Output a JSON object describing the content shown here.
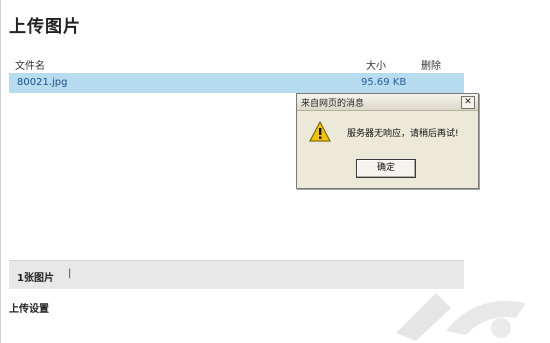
{
  "page": {
    "title": "上传图片"
  },
  "file_list": {
    "columns": {
      "name": "文件名",
      "size": "大小",
      "delete": "删除"
    },
    "rows": [
      {
        "name": "80021.jpg",
        "size": "95.69 KB"
      }
    ]
  },
  "footer": {
    "count": "1张图片",
    "separator": "|"
  },
  "upload_settings": {
    "label": "上传设置"
  },
  "dialog": {
    "title": "来自网页的消息",
    "message": "服务器无响应，请稍后再试!",
    "ok_label": "确定",
    "close_label": "✕"
  },
  "colors": {
    "selected_row": "#b7dcf0",
    "footer_bar": "#e8e8e8",
    "dialog_bg": "#ece9d8",
    "warning": "#f5c400"
  },
  "icons": {
    "dialog_icon": "warning-icon",
    "watermark": "logo-watermark"
  }
}
